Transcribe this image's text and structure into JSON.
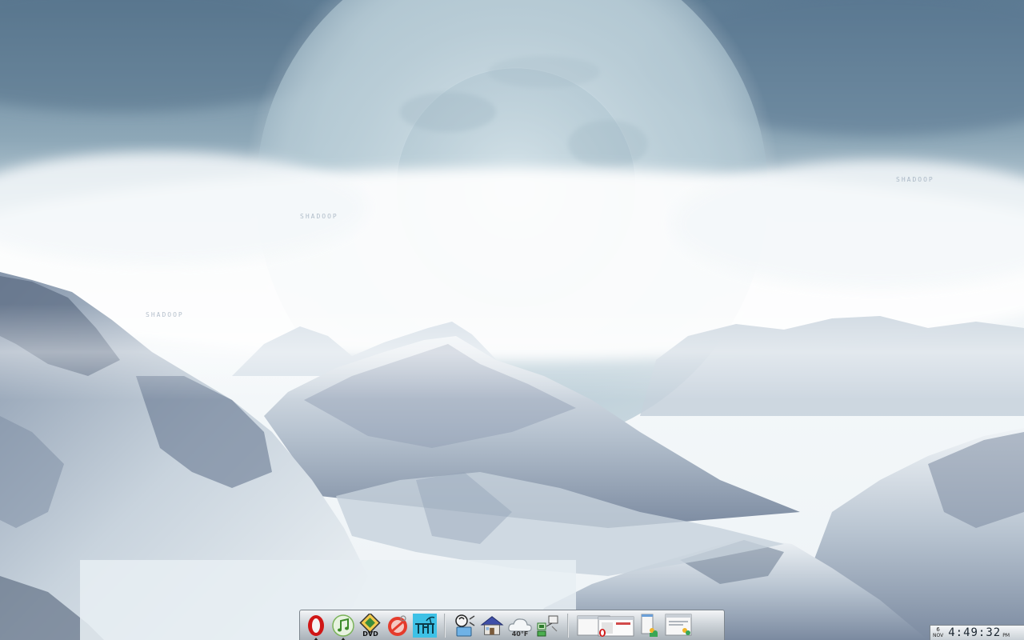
{
  "desktop": {
    "wallpaper": "snowy-mountains-moon-wallpaper",
    "watermarks": [
      "SHADOOP",
      "SHADOOP",
      "SHADOOP"
    ]
  },
  "dock": {
    "launchers": [
      {
        "name": "opera",
        "icon": "opera-icon",
        "running": true
      },
      {
        "name": "itunes",
        "icon": "music-note-icon",
        "running": true
      },
      {
        "name": "dvd-player",
        "icon": "dvd-icon",
        "running": false
      },
      {
        "name": "no-entry",
        "icon": "prohibited-icon",
        "running": false
      },
      {
        "name": "tm-app",
        "icon": "tm-beach-icon",
        "running": false
      }
    ],
    "utilities": [
      {
        "name": "desktop-tool",
        "icon": "paint-tool-icon"
      },
      {
        "name": "home",
        "icon": "house-icon"
      },
      {
        "name": "weather",
        "icon": "cloud-icon",
        "temperature": "40°F"
      },
      {
        "name": "network",
        "icon": "network-icon"
      }
    ],
    "windows": [
      {
        "name": "opera-window",
        "icon": "opera-window-thumb-icon"
      },
      {
        "name": "chat-window",
        "icon": "messenger-window-thumb-icon"
      },
      {
        "name": "messenger-window",
        "icon": "messenger-window-thumb-icon"
      }
    ]
  },
  "clock": {
    "day": "6",
    "month": "NOV",
    "time": "4:49:32",
    "ampm": "PM"
  },
  "colors": {
    "sky_top": "#5e7c94",
    "haze": "#e9f1f4",
    "snow": "#f2f6f8",
    "rock_shadow": "#6f7f95"
  }
}
